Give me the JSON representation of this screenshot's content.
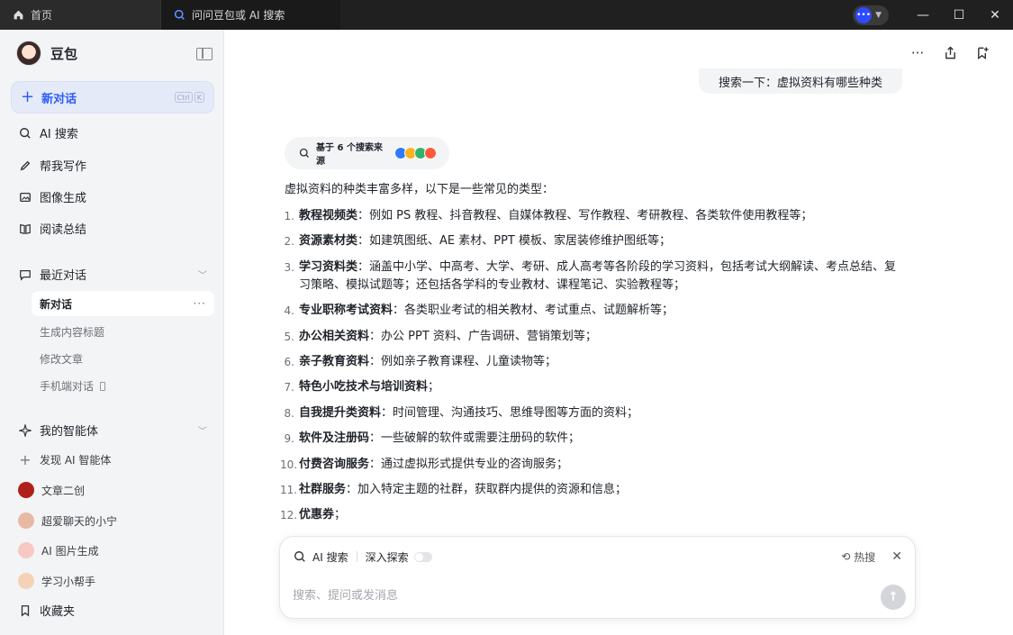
{
  "titlebar": {
    "tabs": [
      {
        "label": "首页",
        "icon": "home-icon"
      },
      {
        "label": "问问豆包或 AI 搜索",
        "icon": "ai-search-icon"
      }
    ],
    "buttons": {
      "minimize": "—",
      "maximize": "☐",
      "close": "✕"
    }
  },
  "sidebar": {
    "brand": "豆包",
    "new_chat": {
      "label": "新对话",
      "shortcut": [
        "Ctrl",
        "K"
      ]
    },
    "nav": [
      {
        "label": "AI 搜索",
        "icon": "search-icon"
      },
      {
        "label": "帮我写作",
        "icon": "pen-icon"
      },
      {
        "label": "图像生成",
        "icon": "image-icon"
      },
      {
        "label": "阅读总结",
        "icon": "book-icon"
      }
    ],
    "recent_header": "最近对话",
    "recent": [
      "新对话",
      "生成内容标题",
      "修改文章",
      "手机端对话"
    ],
    "agents_header": "我的智能体",
    "discover": "发现 AI 智能体",
    "agents": [
      "文章二创",
      "超爱聊天的小宁",
      "AI 图片生成",
      "学习小帮手"
    ],
    "favorites": "收藏夹"
  },
  "main": {
    "user_message": "搜索一下：虚拟资料有哪些种类",
    "sources_label": "基于 6 个搜索来源",
    "intro": "虚拟资料的种类丰富多样，以下是一些常见的类型：",
    "items": [
      {
        "n": "1.",
        "title": "教程视频类",
        "desc": "：例如 PS 教程、抖音教程、自媒体教程、写作教程、考研教程、各类软件使用教程等；"
      },
      {
        "n": "2.",
        "title": "资源素材类",
        "desc": "：如建筑图纸、AE 素材、PPT 模板、家居装修维护图纸等；"
      },
      {
        "n": "3.",
        "title": "学习资料类",
        "desc": "：涵盖中小学、中高考、大学、考研、成人高考等各阶段的学习资料，包括考试大纲解读、考点总结、复习策略、模拟试题等；还包括各学科的专业教材、课程笔记、实验教程等；"
      },
      {
        "n": "4.",
        "title": "专业职称考试资料",
        "desc": "：各类职业考试的相关教材、考试重点、试题解析等；"
      },
      {
        "n": "5.",
        "title": "办公相关资料",
        "desc": "：办公 PPT 资料、广告调研、营销策划等；"
      },
      {
        "n": "6.",
        "title": "亲子教育资料",
        "desc": "：例如亲子教育课程、儿童读物等；"
      },
      {
        "n": "7.",
        "title": "特色小吃技术与培训资料",
        "desc": "；"
      },
      {
        "n": "8.",
        "title": "自我提升类资料",
        "desc": "：时间管理、沟通技巧、思维导图等方面的资料；"
      },
      {
        "n": "9.",
        "title": "软件及注册码",
        "desc": "：一些破解的软件或需要注册码的软件；"
      },
      {
        "n": "10.",
        "title": "付费咨询服务",
        "desc": "：通过虚拟形式提供专业的咨询服务；"
      },
      {
        "n": "11.",
        "title": "社群服务",
        "desc": "：加入特定主题的社群，获取群内提供的资源和信息；"
      },
      {
        "n": "12.",
        "title": "优惠券",
        "desc": "；"
      }
    ]
  },
  "composer": {
    "mode": "AI 搜索",
    "deep": "深入探索",
    "hot": "热搜",
    "placeholder": "搜索、提问或发消息"
  }
}
